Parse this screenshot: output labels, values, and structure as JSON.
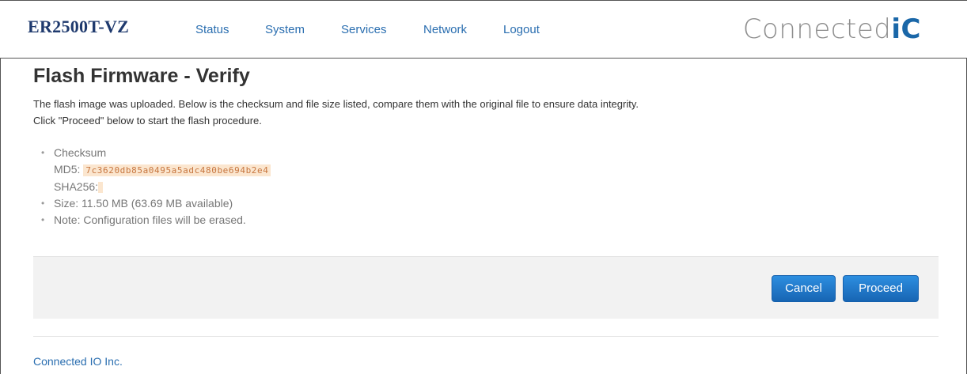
{
  "header": {
    "device_name": "ER2500T-VZ",
    "nav": [
      "Status",
      "System",
      "Services",
      "Network",
      "Logout"
    ],
    "logo": {
      "text_main": "Connected",
      "text_accent": "iC"
    }
  },
  "main": {
    "title": "Flash Firmware - Verify",
    "description": [
      "The flash image was uploaded. Below is the checksum and file size listed, compare them with the original file to ensure data integrity.",
      "Click \"Proceed\" below to start the flash procedure."
    ],
    "details": {
      "checksum_label": "Checksum",
      "md5_label": "MD5:",
      "md5_value": "7c3620db85a0495a5adc480be694b2e4",
      "sha256_label": "SHA256:",
      "sha256_value": "",
      "size": "Size: 11.50 MB (63.69 MB available)",
      "note": "Note: Configuration files will be erased."
    },
    "buttons": {
      "cancel": "Cancel",
      "proceed": "Proceed"
    }
  },
  "footer": {
    "text": "Connected IO Inc."
  },
  "colors": {
    "link": "#2a6eb0",
    "brand_title": "#1f3a6e",
    "button": "#1765b3",
    "hash_bg": "#fbe6cf",
    "hash_text": "#c7763f"
  }
}
